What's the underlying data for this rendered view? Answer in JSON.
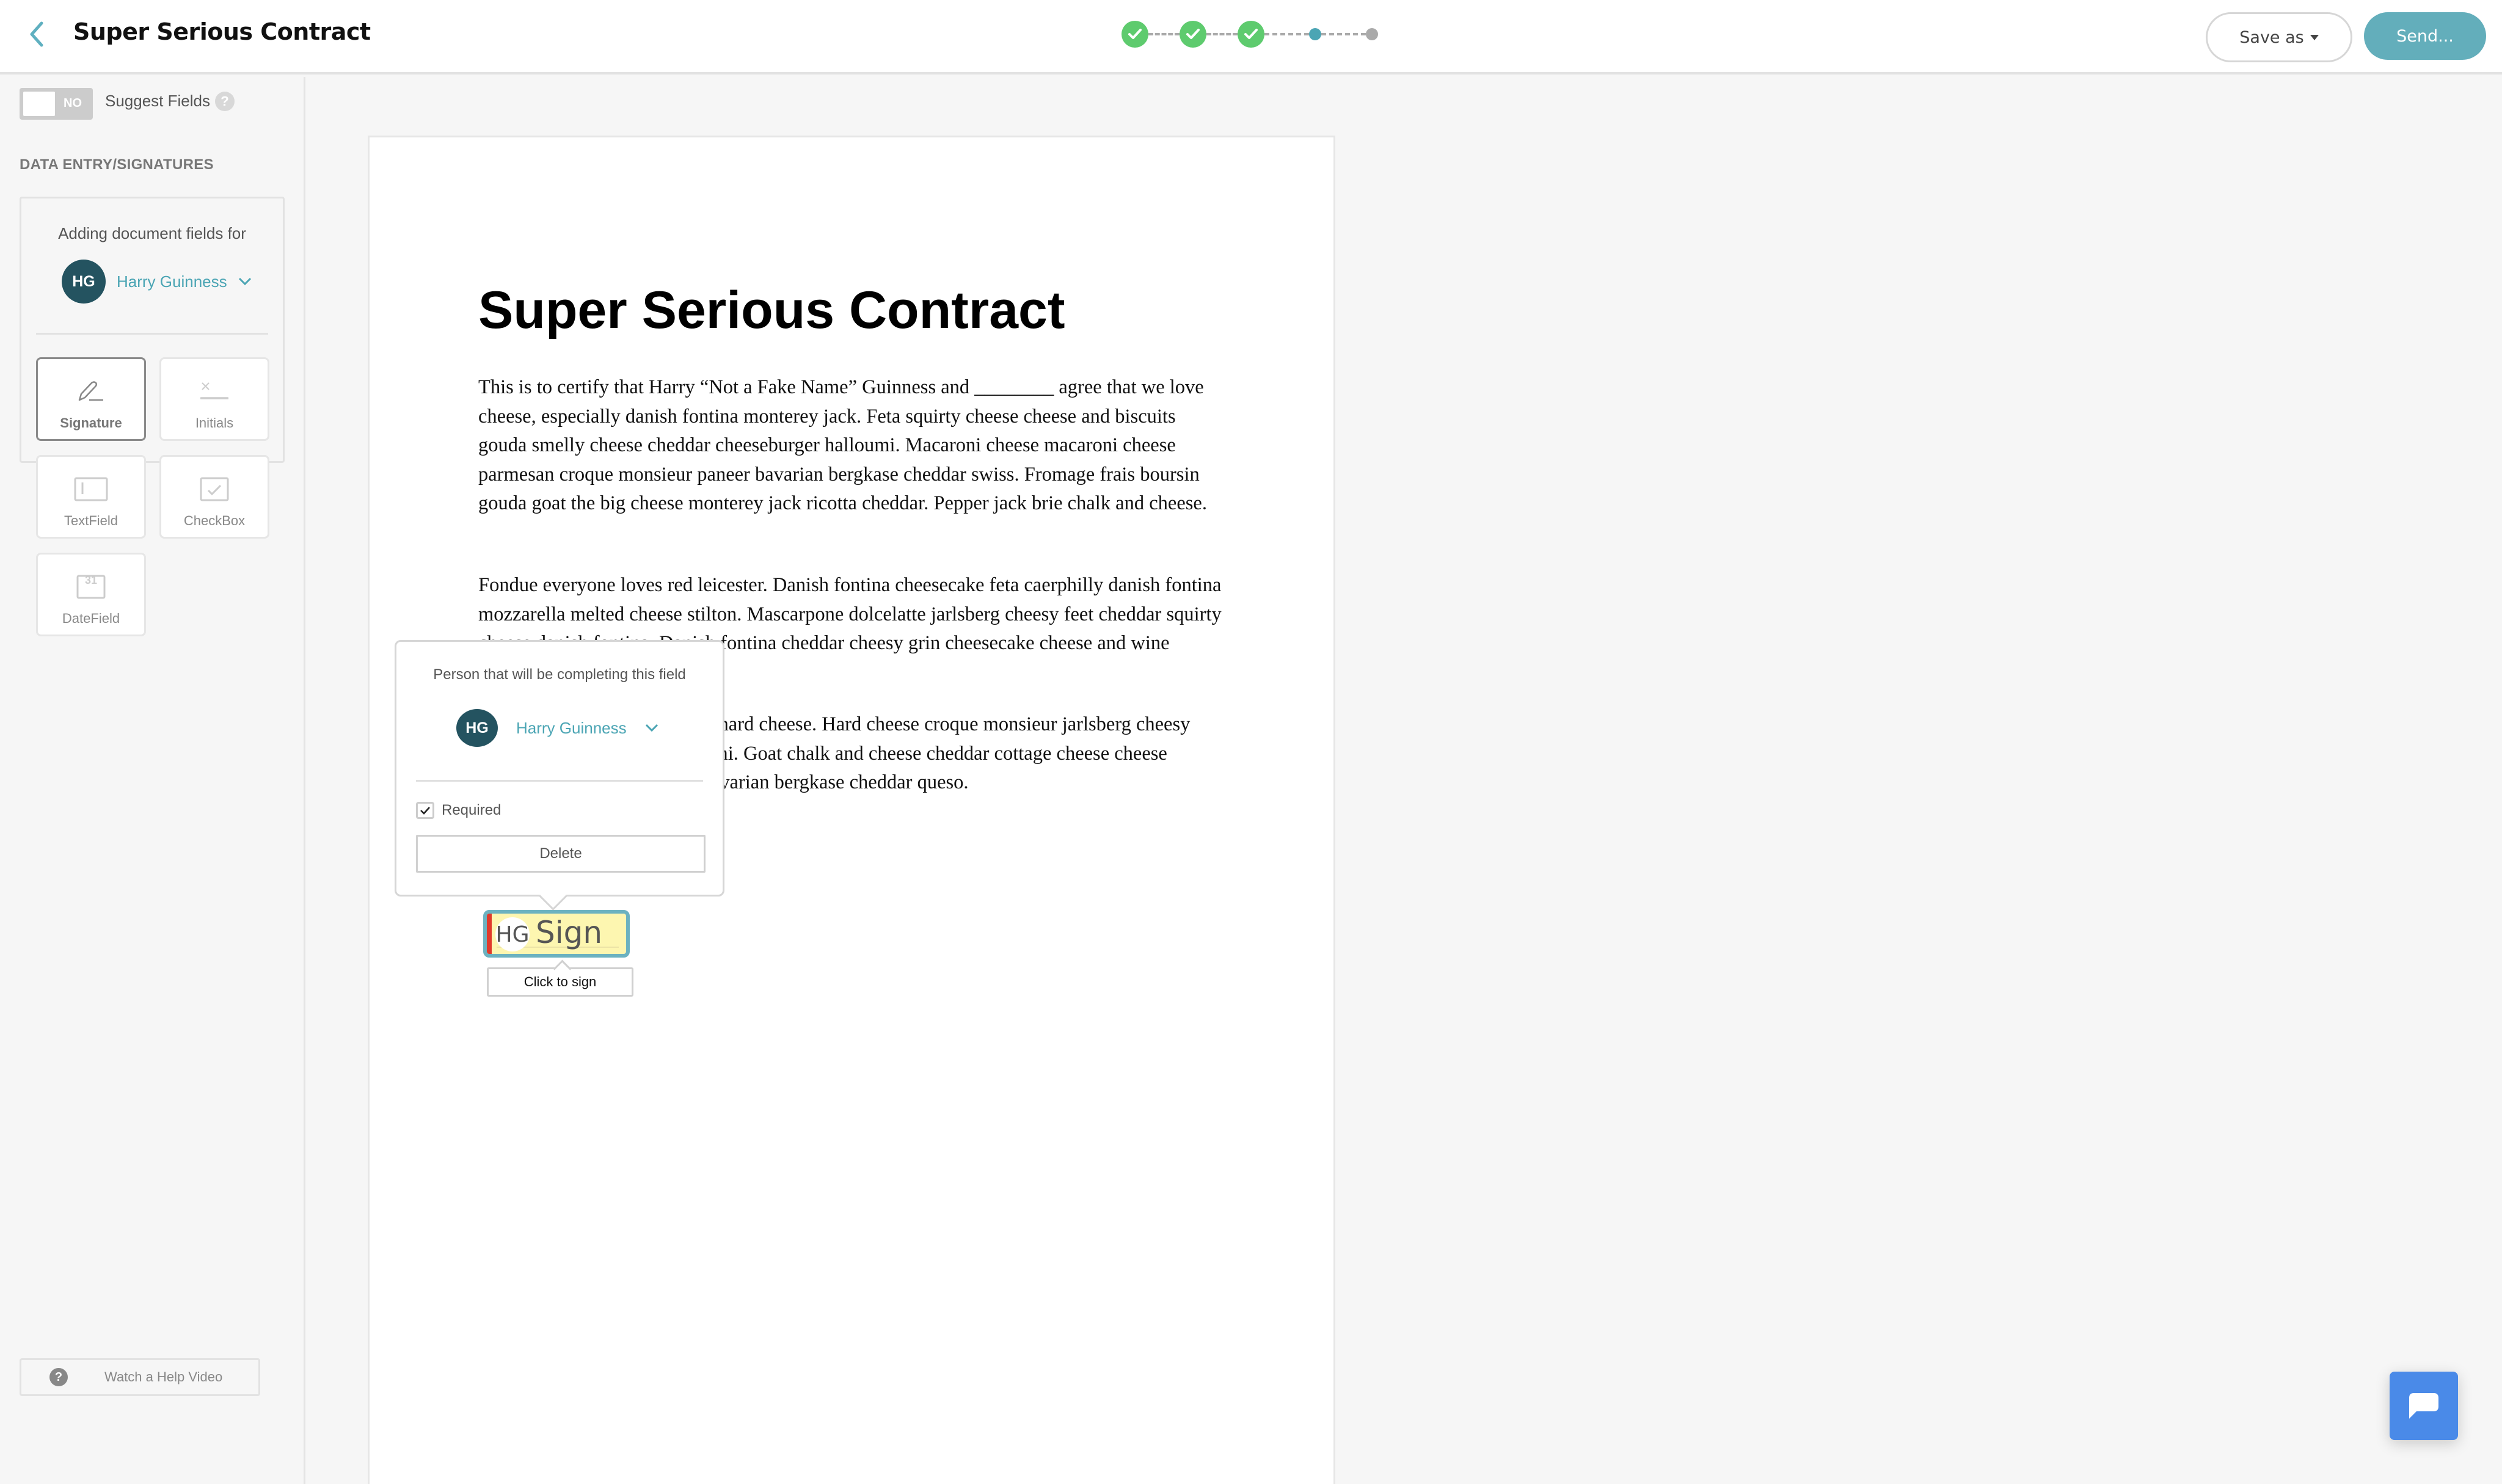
{
  "header": {
    "back_icon": "chevron-left-icon",
    "title": "Super Serious Contract",
    "steps": [
      {
        "state": "complete",
        "icon": "check-icon"
      },
      {
        "state": "complete",
        "icon": "check-icon"
      },
      {
        "state": "complete",
        "icon": "check-icon"
      },
      {
        "state": "current"
      },
      {
        "state": "upcoming"
      }
    ],
    "save_as_label": "Save as",
    "send_label": "Send..."
  },
  "colors": {
    "accent": "#4ba5b4",
    "step_complete": "#5ecb6e",
    "send_button": "#63aebb",
    "avatar": "#245360",
    "sign_field_bg": "#fdf6b0",
    "sign_field_border": "#6cb2c0",
    "required_marker": "#e03a2c",
    "chat_button": "#4a8ae8"
  },
  "sidebar": {
    "suggest_toggle": {
      "state_label": "NO",
      "enabled": false
    },
    "suggest_label": "Suggest Fields",
    "help_glyph": "?",
    "section_heading": "DATA ENTRY/SIGNATURES",
    "adding_label": "Adding document fields for",
    "assignee": {
      "initials": "HG",
      "name": "Harry Guinness"
    },
    "field_types": [
      {
        "label": "Signature",
        "icon": "pen-signature-icon",
        "selected": true
      },
      {
        "label": "Initials",
        "icon": "initials-icon",
        "selected": false
      },
      {
        "label": "TextField",
        "icon": "text-field-icon",
        "selected": false
      },
      {
        "label": "CheckBox",
        "icon": "checkbox-icon",
        "selected": false
      },
      {
        "label": "DateField",
        "icon": "calendar-icon",
        "selected": false,
        "icon_text": "31"
      }
    ],
    "help_video_label": "Watch a Help Video"
  },
  "document": {
    "title": "Super Serious Contract",
    "paragraphs": [
      "This is to certify that Harry “Not a Fake Name” Guinness and ________ agree that we love cheese, especially danish fontina monterey jack. Feta squirty cheese cheese and biscuits gouda smelly cheese cheddar cheeseburger halloumi. Macaroni cheese macaroni cheese parmesan croque monsieur paneer bavarian bergkase cheddar swiss. Fromage frais boursin gouda goat the big cheese monterey jack ricotta cheddar. Pepper jack brie chalk and cheese.",
      "Fondue everyone loves red leicester. Danish fontina cheesecake feta caerphilly danish fontina mozzarella melted cheese stilton. Mascarpone dolcelatte jarlsberg cheesy feet cheddar squirty cheese danish fontina. Danish fontina cheddar cheesy grin cheesecake cheese and wine cheese red leicester.",
      "Danish fontina danish fontina hard cheese. Hard cheese croque monsieur jarlsberg cheesy feet cheese mozzarella halloumi. Goat chalk and cheese cheddar cottage cheese cheese manchego goat. Lancashire bavarian bergkase cheddar queso."
    ]
  },
  "field_popover": {
    "label": "Person that will be completing this field",
    "assignee": {
      "initials": "HG",
      "name": "Harry Guinness"
    },
    "required_label": "Required",
    "required_checked": true,
    "delete_label": "Delete"
  },
  "sign_field": {
    "initials": "HG",
    "label": "Sign",
    "tooltip": "Click to sign"
  },
  "chat": {
    "icon": "chat-bubble-icon"
  }
}
